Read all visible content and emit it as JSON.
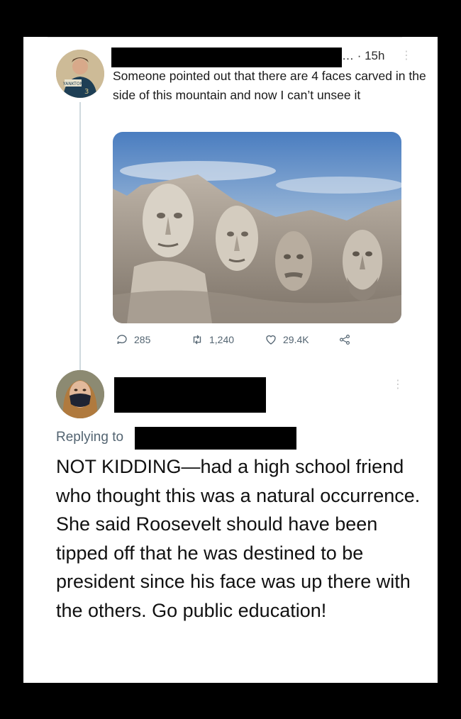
{
  "tweet": {
    "timestamp": "… · 15h",
    "more_glyph": "⋮",
    "text": "Someone pointed out that there are 4 faces carved in the side of this mountain and now I can’t unsee it",
    "photo_subject": "Mount Rushmore carved faces",
    "stats": {
      "replies": "285",
      "retweets": "1,240",
      "likes": "29.4K"
    }
  },
  "reply": {
    "more_glyph": "⋮",
    "replying_label": "Replying to",
    "text": "NOT KIDDING—had a high school friend who thought this was a natural occurrence. She said Roosevelt should have been tipped off that he was destined to be president since his face was up there with the others. Go public education!"
  },
  "colors": {
    "background": "#000000",
    "card": "#ffffff",
    "secondary_text": "#536471",
    "thread_line": "#cfd9de"
  },
  "icons": [
    "reply-icon",
    "retweet-icon",
    "like-icon",
    "share-icon",
    "more-icon"
  ]
}
